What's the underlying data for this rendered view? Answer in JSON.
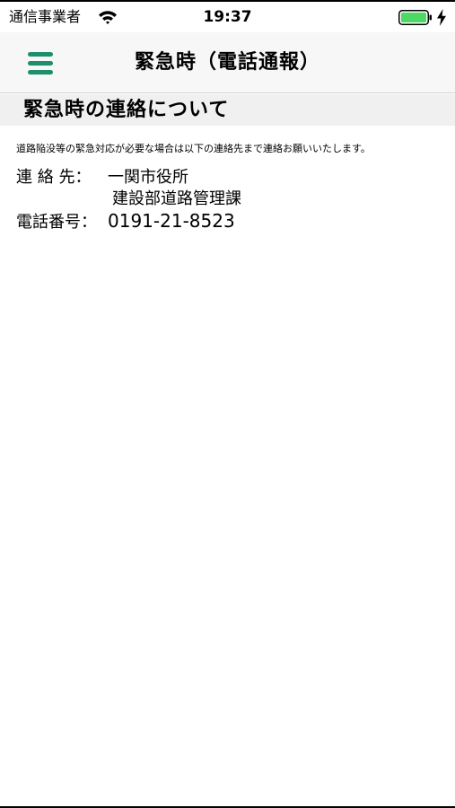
{
  "status_bar": {
    "carrier": "通信事業者",
    "time": "19:37",
    "wifi_icon": "wifi-icon",
    "battery_icon": "battery-full-icon",
    "charging_icon": "charging-bolt-icon",
    "battery_color": "#4cd964"
  },
  "nav": {
    "menu_icon": "hamburger-menu-icon",
    "accent_color": "#1f8f6b",
    "title": "緊急時（電話通報）"
  },
  "section": {
    "title": "緊急時の連絡について"
  },
  "content": {
    "notice": "道路陥没等の緊急対応が必要な場合は以下の連絡先まで連絡お願いいたします。",
    "contact_label": "連 絡 先：",
    "contact_org": "一関市役所",
    "contact_dept": "建設部道路管理課",
    "phone_label": "電話番号：",
    "phone_number": "0191-21-8523"
  }
}
